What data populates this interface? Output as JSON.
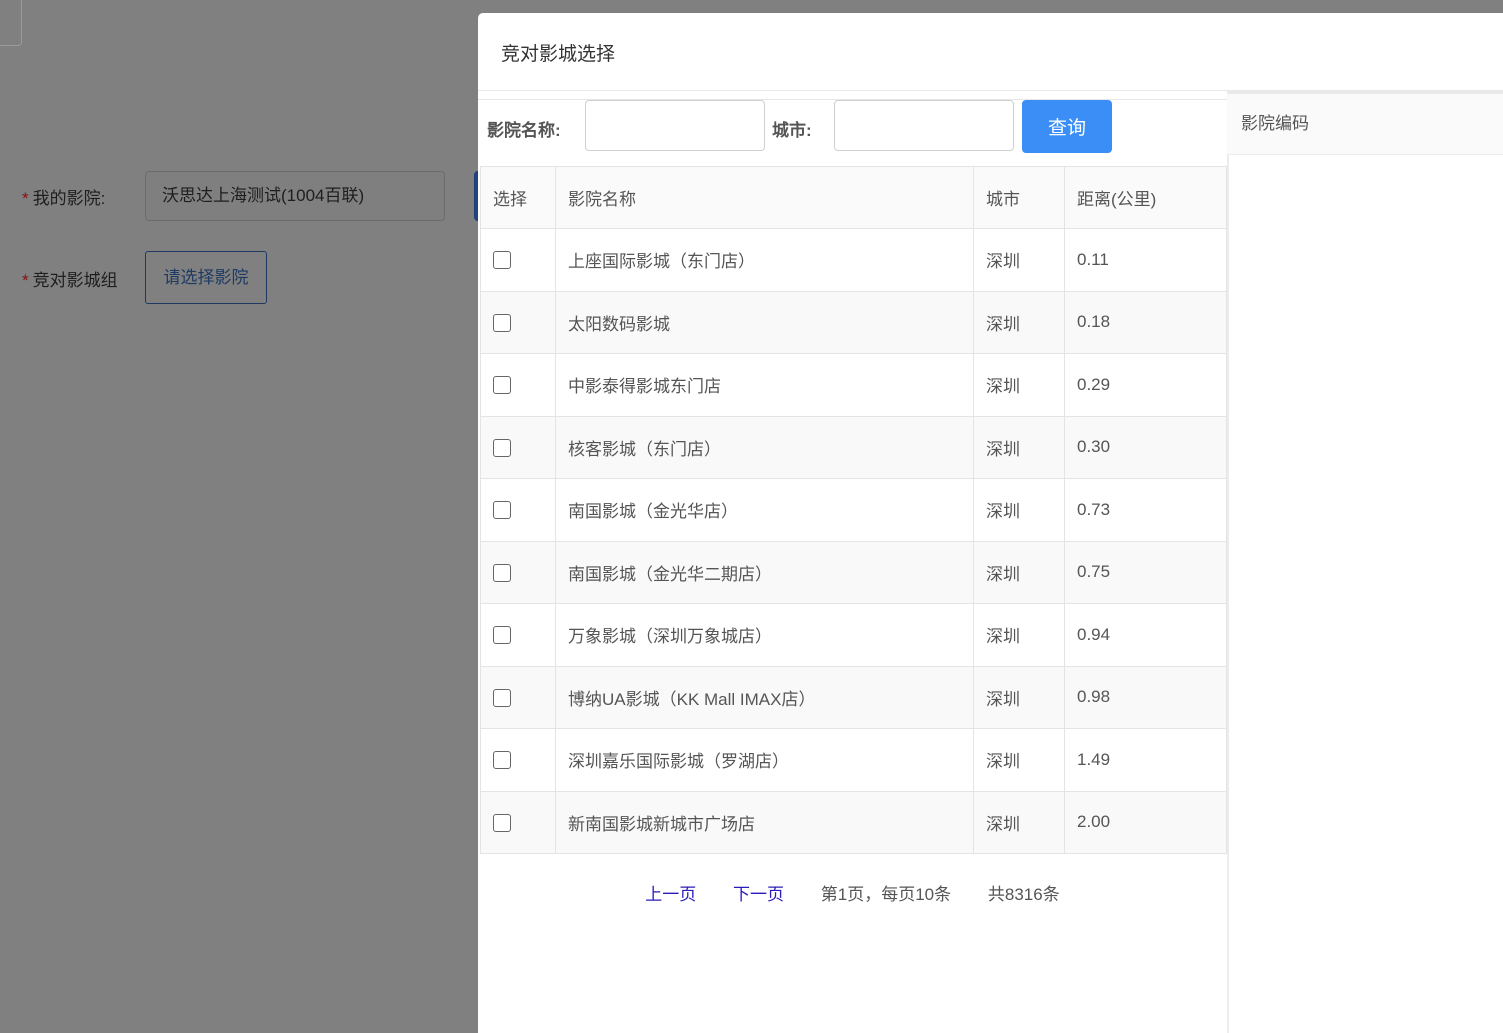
{
  "background_form": {
    "my_cinema_label": "我的影院:",
    "my_cinema_value": "沃思达上海测试(1004百联)",
    "competitor_group_label": "竞对影城组",
    "select_cinema_button": "请选择影院",
    "required_mark": "*"
  },
  "modal": {
    "title": "竞对影城选择",
    "search": {
      "name_label": "影院名称:",
      "name_value": "",
      "city_label": "城市:",
      "city_value": "",
      "query_button": "查询"
    },
    "table": {
      "headers": {
        "select": "选择",
        "name": "影院名称",
        "city": "城市",
        "distance": "距离(公里)"
      },
      "rows": [
        {
          "name": "上座国际影城（东门店）",
          "city": "深圳",
          "distance": "0.11"
        },
        {
          "name": "太阳数码影城",
          "city": "深圳",
          "distance": "0.18"
        },
        {
          "name": "中影泰得影城东门店",
          "city": "深圳",
          "distance": "0.29"
        },
        {
          "name": "核客影城（东门店）",
          "city": "深圳",
          "distance": "0.30"
        },
        {
          "name": "南国影城（金光华店）",
          "city": "深圳",
          "distance": "0.73"
        },
        {
          "name": "南国影城（金光华二期店）",
          "city": "深圳",
          "distance": "0.75"
        },
        {
          "name": "万象影城（深圳万象城店）",
          "city": "深圳",
          "distance": "0.94"
        },
        {
          "name": "博纳UA影城（KK Mall IMAX店）",
          "city": "深圳",
          "distance": "0.98"
        },
        {
          "name": "深圳嘉乐国际影城（罗湖店）",
          "city": "深圳",
          "distance": "1.49"
        },
        {
          "name": "新南国影城新城市广场店",
          "city": "深圳",
          "distance": "2.00"
        }
      ]
    },
    "pagination": {
      "prev": "上一页",
      "next": "下一页",
      "page_info": "第1页，每页10条",
      "total": "共8316条"
    },
    "selected_panel": {
      "header": "影院编码"
    }
  }
}
